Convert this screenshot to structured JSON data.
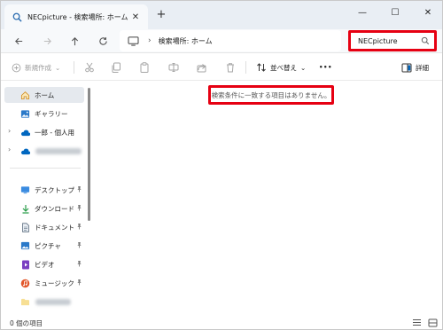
{
  "tab": {
    "title": "NECpicture - 検索場所: ホーム",
    "icon": "search-icon"
  },
  "window_controls": {
    "minimize": "—",
    "maximize": "☐",
    "close": "✕"
  },
  "nav": {
    "crumb": "検索場所: ホーム",
    "separator": "›"
  },
  "search": {
    "query": "NECpicture"
  },
  "commands": {
    "new": "新規作成",
    "new_arrow": "⌄",
    "sort": "並べ替え",
    "sort_arrow": "⌄",
    "more": "•••",
    "details": "詳細"
  },
  "sidebar": {
    "home": "ホーム",
    "gallery": "ギャラリー",
    "onedrive": "一郎 - 個人用",
    "quick_access": [
      {
        "label": "デスクトップ",
        "icon": "desktop-icon"
      },
      {
        "label": "ダウンロード",
        "icon": "download-icon"
      },
      {
        "label": "ドキュメント",
        "icon": "document-icon"
      },
      {
        "label": "ピクチャ",
        "icon": "picture-icon"
      },
      {
        "label": "ビデオ",
        "icon": "video-icon"
      },
      {
        "label": "ミュージック",
        "icon": "music-icon"
      }
    ],
    "pin": "📌"
  },
  "content": {
    "empty_message": "検索条件に一致する項目はありません。"
  },
  "status": {
    "item_count": "0 個の項目"
  },
  "colors": {
    "highlight": "#e60012",
    "accent": "#0067c0",
    "selected_bg": "#e5e9ee"
  }
}
